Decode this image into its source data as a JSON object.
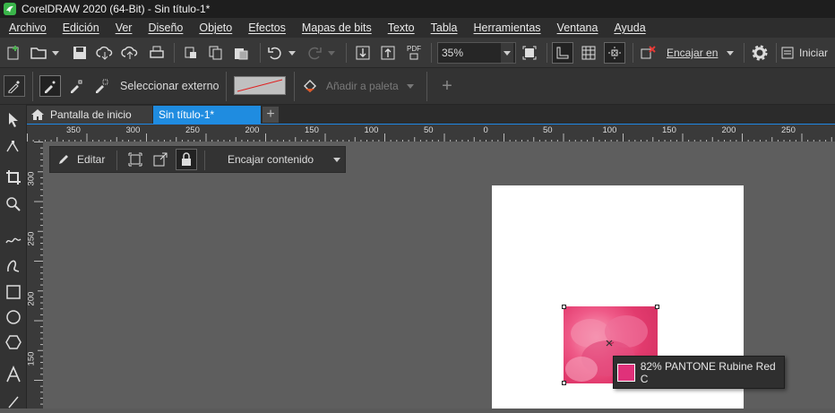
{
  "window": {
    "title": "CorelDRAW 2020 (64-Bit) - Sin título-1*"
  },
  "menu": [
    "Archivo",
    "Edición",
    "Ver",
    "Diseño",
    "Objeto",
    "Efectos",
    "Mapas de bits",
    "Texto",
    "Tabla",
    "Herramientas",
    "Ventana",
    "Ayuda"
  ],
  "toolbar": {
    "zoom_value": "35%",
    "snap_label": "Encajar en",
    "pdf_label": "PDF",
    "iniciar_label": "Iniciar"
  },
  "propbar": {
    "select_external_label": "Seleccionar externo",
    "add_palette_label": "Añadir a paleta",
    "sample_color": "#c0c0c0",
    "sample_line_color": "#e02020"
  },
  "tabs": {
    "home": "Pantalla de inicio",
    "doc": "Sin título-1*",
    "add": "+"
  },
  "hruler": [
    "350",
    "300",
    "250",
    "200",
    "150",
    "100",
    "50",
    "0",
    "50",
    "100",
    "150",
    "200",
    "250"
  ],
  "vruler": [
    "300",
    "250",
    "200",
    "150"
  ],
  "floatbar": {
    "edit_label": "Editar",
    "fit_label": "Encajar contenido"
  },
  "tooltip": {
    "text": "82% PANTONE Rubine Red C",
    "swatch_color": "#e0317a"
  }
}
